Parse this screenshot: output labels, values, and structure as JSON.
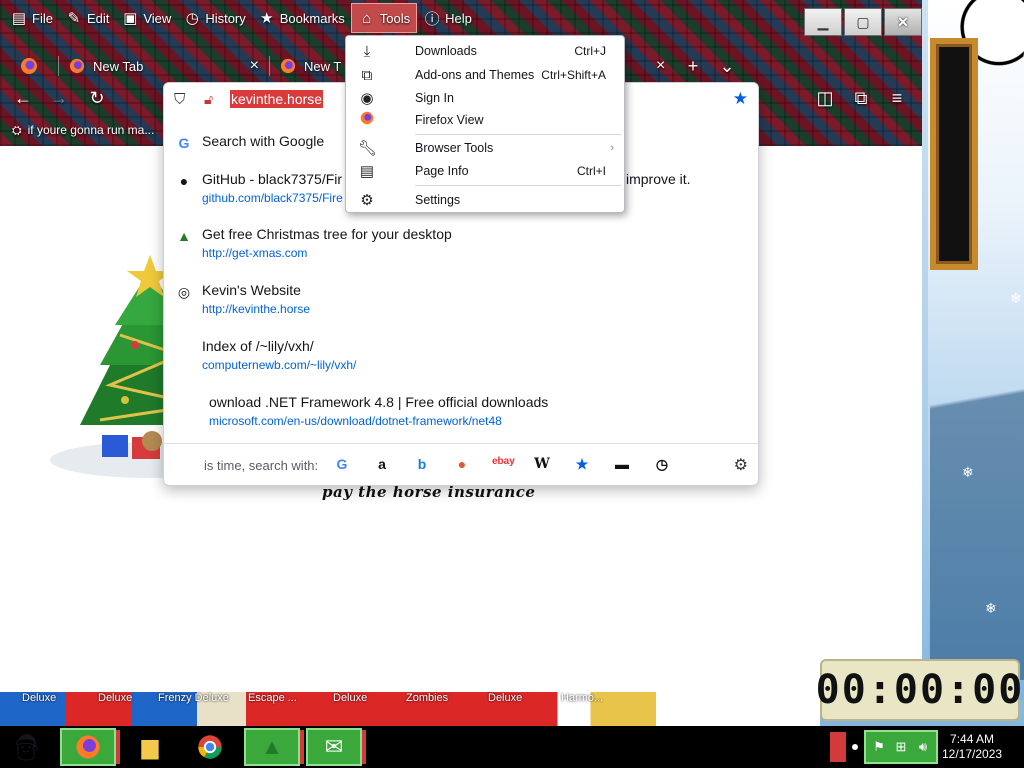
{
  "menubar": {
    "items": [
      {
        "label": "File",
        "icon": "file-icon"
      },
      {
        "label": "Edit",
        "icon": "edit-icon"
      },
      {
        "label": "View",
        "icon": "view-icon"
      },
      {
        "label": "History",
        "icon": "history-icon"
      },
      {
        "label": "Bookmarks",
        "icon": "bookmarks-icon"
      },
      {
        "label": "Tools",
        "icon": "tools-icon",
        "active": true
      },
      {
        "label": "Help",
        "icon": "help-icon"
      }
    ]
  },
  "tabs": [
    {
      "label": "New Tab"
    },
    {
      "label": "New T"
    }
  ],
  "bookmarks_bar": {
    "items": [
      {
        "label": "if youre gonna run ma..."
      }
    ]
  },
  "urlbar": {
    "value": "kevinthe.horse"
  },
  "suggestions": [
    {
      "title": "Search with Google",
      "url": "",
      "icon": "google-icon"
    },
    {
      "title": "GitHub - black7375/Fir",
      "title_tail": "improve it.",
      "url": "github.com/black7375/Fire",
      "icon": "github-icon"
    },
    {
      "title": "Get free Christmas tree for your desktop",
      "url": "http://get-xmas.com",
      "icon": "tree-icon"
    },
    {
      "title": "Kevin's Website",
      "url": "http://kevinthe.horse",
      "icon": "globe-icon"
    },
    {
      "title": "Index of /~lily/vxh/",
      "url": "computernewb.com/~lily/vxh/",
      "icon": "folder-icon"
    },
    {
      "title": "ownload .NET Framework 4.8 | Free official downloads",
      "url": "microsoft.com/en-us/download/dotnet-framework/net48",
      "icon": "download-icon"
    }
  ],
  "one_off": {
    "label": "is time, search with:",
    "engines": [
      "google",
      "amazon",
      "bing",
      "duckduckgo",
      "ebay",
      "wikipedia",
      "bookmarks",
      "tabs",
      "history"
    ]
  },
  "tools_menu": {
    "items": [
      {
        "label": "Downloads",
        "shortcut": "Ctrl+J",
        "icon": "download-icon"
      },
      {
        "label": "Add-ons and Themes",
        "shortcut": "Ctrl+Shift+A",
        "icon": "puzzle-icon"
      },
      {
        "label": "Sign In",
        "shortcut": "",
        "icon": "account-icon"
      },
      {
        "label": "Firefox View",
        "shortcut": "",
        "icon": "firefox-icon"
      },
      {
        "label": "Browser Tools",
        "shortcut": "",
        "icon": "wrench-icon",
        "submenu": true
      },
      {
        "label": "Page Info",
        "shortcut": "Ctrl+I",
        "icon": "page-info-icon"
      },
      {
        "label": "Settings",
        "shortcut": "",
        "icon": "gear-icon"
      }
    ]
  },
  "page": {
    "text": "pay the horse insurance"
  },
  "game_strip": {
    "labels": [
      "Deluxe",
      "Deluxe",
      "Frenzy Deluxe",
      "Escape ...",
      "Deluxe",
      "Zombies",
      "Deluxe",
      "Harmo..."
    ]
  },
  "timer": {
    "value": "00:00:00"
  },
  "clock": {
    "time": "7:44 AM",
    "date": "12/17/2023"
  },
  "colors": {
    "accent": "#0060df",
    "highlight": "#d93a3a",
    "link": "#0061e0"
  }
}
